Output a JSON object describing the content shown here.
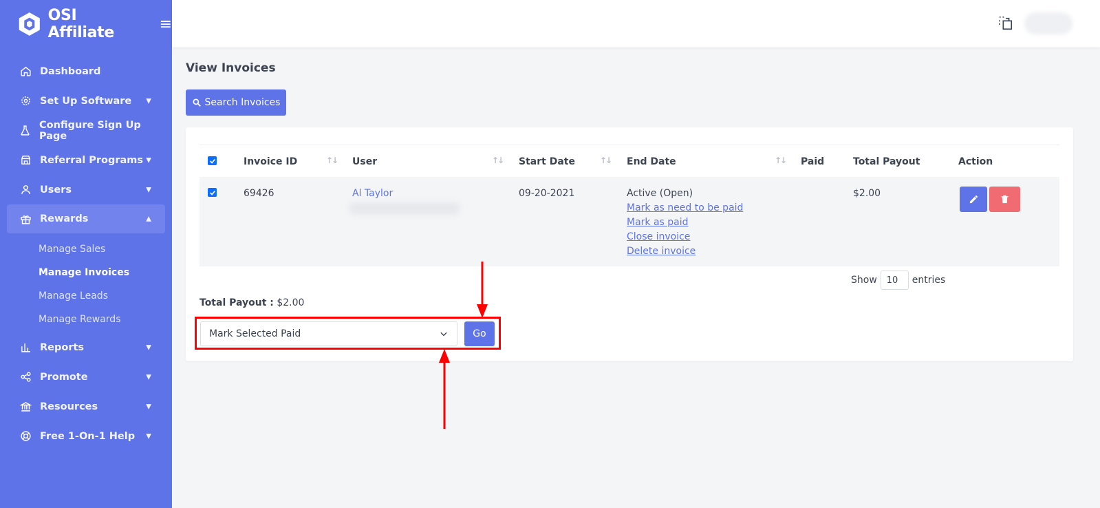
{
  "app": {
    "name": "OSI Affiliate"
  },
  "sidebar": {
    "items": [
      {
        "label": "Dashboard",
        "icon": "home-icon",
        "has_chevron": false
      },
      {
        "label": "Set Up Software",
        "icon": "gear-icon",
        "has_chevron": true
      },
      {
        "label": "Configure Sign Up Page",
        "icon": "flask-icon",
        "has_chevron": false
      },
      {
        "label": "Referral Programs",
        "icon": "store-icon",
        "has_chevron": true
      },
      {
        "label": "Users",
        "icon": "user-icon",
        "has_chevron": true
      },
      {
        "label": "Rewards",
        "icon": "gift-icon",
        "has_chevron": true,
        "expanded": true
      }
    ],
    "rewards_sub": [
      "Manage Sales",
      "Manage Invoices",
      "Manage Leads",
      "Manage Rewards"
    ],
    "rewards_current": "Manage Invoices",
    "items_after": [
      {
        "label": "Reports",
        "icon": "bar-chart-icon"
      },
      {
        "label": "Promote",
        "icon": "share-icon"
      },
      {
        "label": "Resources",
        "icon": "bank-icon"
      },
      {
        "label": "Free 1-On-1 Help",
        "icon": "lifebuoy-icon"
      }
    ]
  },
  "page": {
    "title": "View Invoices",
    "search_button": "Search Invoices"
  },
  "table": {
    "headers": [
      "Invoice ID",
      "User",
      "Start Date",
      "End Date",
      "Paid",
      "Total Payout",
      "Action"
    ],
    "rows": [
      {
        "invoice_id": "69426",
        "user": "Al Taylor",
        "start_date": "09-20-2021",
        "status": "Active (Open)",
        "actions": [
          "Mark as need to be paid",
          "Mark as paid",
          "Close invoice",
          "Delete invoice"
        ],
        "paid": "",
        "total_payout": "$2.00"
      }
    ]
  },
  "entries": {
    "show": "Show",
    "value": "10",
    "suffix": "entries"
  },
  "total_payout": {
    "label": "Total Payout :",
    "value": "$2.00"
  },
  "bulk": {
    "selected": "Mark Selected Paid",
    "go": "Go"
  },
  "colors": {
    "sidebar": "#5f73e8",
    "primary": "#5f73e8",
    "danger": "#f16b72",
    "annotation": "#ff0000"
  }
}
